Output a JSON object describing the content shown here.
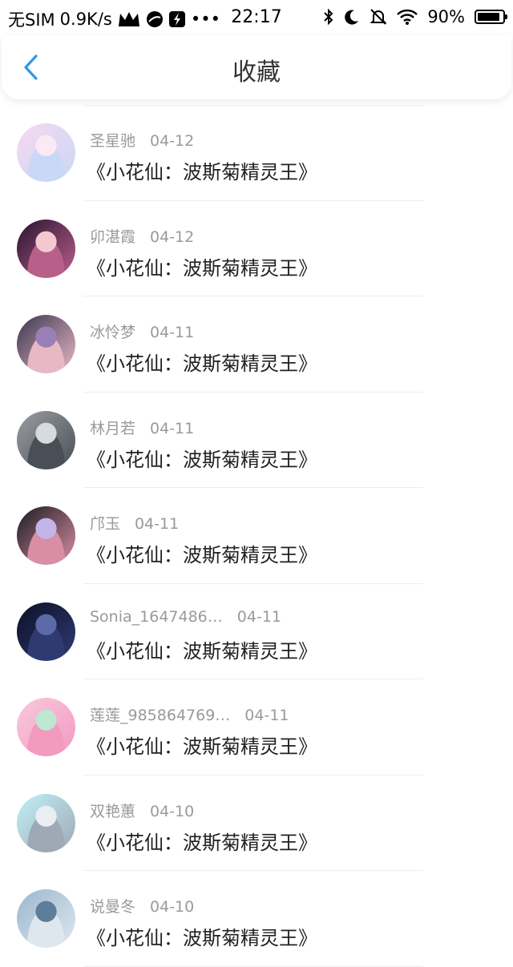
{
  "status_bar": {
    "carrier": "无SIM",
    "speed": "0.9K/s",
    "more": "•••",
    "time": "22:17",
    "battery_pct": "90%",
    "battery_level": 0.9
  },
  "nav": {
    "title": "收藏"
  },
  "favorites": [
    {
      "name": "圣星驰",
      "date": "04-12",
      "title": "《小花仙：波斯菊精灵王》",
      "avatar_colors": [
        "#f6d9ee",
        "#c9d8f7",
        "#fbeaf3"
      ]
    },
    {
      "name": "卯湛霞",
      "date": "04-12",
      "title": "《小花仙：波斯菊精灵王》",
      "avatar_colors": [
        "#2a1330",
        "#b9608a",
        "#f3c8cf"
      ]
    },
    {
      "name": "冰怜梦",
      "date": "04-11",
      "title": "《小花仙：波斯菊精灵王》",
      "avatar_colors": [
        "#3b3650",
        "#e7b9c4",
        "#9a7fb6"
      ]
    },
    {
      "name": "林月若",
      "date": "04-11",
      "title": "《小花仙：波斯菊精灵王》",
      "avatar_colors": [
        "#9a9ea3",
        "#4a4f57",
        "#d7dade"
      ]
    },
    {
      "name": "邝玉",
      "date": "04-11",
      "title": "《小花仙：波斯菊精灵王》",
      "avatar_colors": [
        "#1b1b22",
        "#d88fa3",
        "#c4b5e8"
      ]
    },
    {
      "name": "Sonia_1647486…",
      "date": "04-11",
      "title": "《小花仙：波斯菊精灵王》",
      "avatar_colors": [
        "#0d1026",
        "#2f3a72",
        "#5d6aa8"
      ]
    },
    {
      "name": "莲莲_985864769…",
      "date": "04-11",
      "title": "《小花仙：波斯菊精灵王》",
      "avatar_colors": [
        "#f8c9dc",
        "#f29ac0",
        "#bfe6d0"
      ]
    },
    {
      "name": "双艳蕙",
      "date": "04-10",
      "title": "《小花仙：波斯菊精灵王》",
      "avatar_colors": [
        "#bff1f5",
        "#9fa8b5",
        "#e8eef2"
      ]
    },
    {
      "name": "说曼冬",
      "date": "04-10",
      "title": "《小花仙：波斯菊精灵王》",
      "avatar_colors": [
        "#9bb7cf",
        "#dfe7ee",
        "#5d7e9b"
      ]
    }
  ],
  "colors": {
    "accent": "#2a9ae8",
    "name_gray": "#9a9a9a",
    "title_text": "#222222",
    "divider": "#eeeeee"
  }
}
